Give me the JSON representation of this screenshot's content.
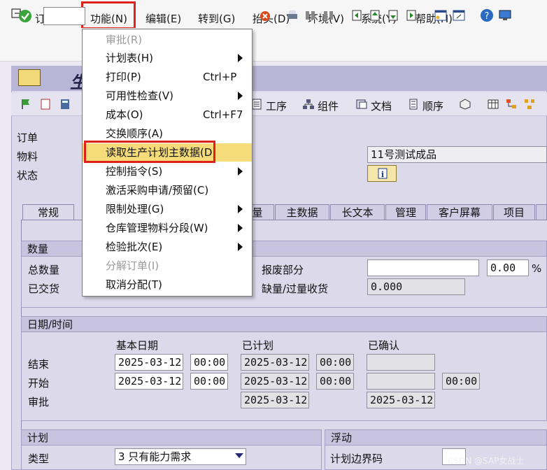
{
  "menubar": {
    "items": [
      "订单(O)",
      "功能(N)",
      "编辑(E)",
      "转到(G)",
      "抬头(D)",
      "环境(V)",
      "系统(Y)",
      "帮助(H)"
    ]
  },
  "screen": {
    "title": "生",
    "app_buttons": [
      "工序",
      "组件",
      "文档",
      "顺序"
    ]
  },
  "header": {
    "order_label": "订单",
    "material_label": "物料",
    "status_label": "状态",
    "material_desc": "11号测试成品",
    "info_symbol": "i"
  },
  "tabs": [
    "常规",
    "量",
    "主数据",
    "长文本",
    "管理",
    "客户屏幕",
    "项目"
  ],
  "quantities": {
    "header": "数量",
    "total_label": "总数量",
    "delivered_label": "已交货",
    "scrap_label": "报废部分",
    "scrap_pct": "0.00",
    "pct_sign": "%",
    "short_over_label": "缺量/过量收货",
    "short_over_value": "0.000"
  },
  "dates": {
    "header": "日期/时间",
    "col_basic": "基本日期",
    "col_planned": "已计划",
    "col_confirmed": "已确认",
    "end_label": "结束",
    "start_label": "开始",
    "release_label": "审批",
    "end_basic_date": "2025-03-12",
    "end_basic_time": "00:00",
    "end_planned_date": "2025-03-12",
    "end_planned_time": "00:00",
    "start_basic_date": "2025-03-12",
    "start_basic_time": "00:00",
    "start_planned_date": "2025-03-12",
    "start_planned_time": "00:00",
    "start_confirmed_time": "00:00",
    "release_planned_date": "2025-03-12",
    "release_confirmed_date": "2025-03-12"
  },
  "planning": {
    "header": "计划",
    "type_label": "类型",
    "type_value": "3 只有能力需求"
  },
  "float": {
    "header": "浮动",
    "sched_margin_label": "计划边界码"
  },
  "dropdown": {
    "items": [
      {
        "label": "审批(R)",
        "shortcut": "",
        "submenu": false,
        "disabled": true
      },
      {
        "label": "计划表(H)",
        "shortcut": "",
        "submenu": true,
        "disabled": false
      },
      {
        "label": "打印(P)",
        "shortcut": "Ctrl+P",
        "submenu": false,
        "disabled": false
      },
      {
        "label": "可用性检查(V)",
        "shortcut": "",
        "submenu": true,
        "disabled": false
      },
      {
        "label": "成本(O)",
        "shortcut": "Ctrl+F7",
        "submenu": false,
        "disabled": false
      },
      {
        "label": "交换顺序(A)",
        "shortcut": "",
        "submenu": false,
        "disabled": false
      },
      {
        "label": "读取生产计划主数据(D)",
        "shortcut": "",
        "submenu": false,
        "disabled": false
      },
      {
        "label": "控制指令(S)",
        "shortcut": "",
        "submenu": true,
        "disabled": false
      },
      {
        "label": "激活采购申请/预留(C)",
        "shortcut": "",
        "submenu": false,
        "disabled": false
      },
      {
        "label": "限制处理(G)",
        "shortcut": "",
        "submenu": true,
        "disabled": false
      },
      {
        "label": "仓库管理物料分段(W)",
        "shortcut": "",
        "submenu": true,
        "disabled": false
      },
      {
        "label": "检验批次(E)",
        "shortcut": "",
        "submenu": true,
        "disabled": false
      },
      {
        "label": "分解订单(I)",
        "shortcut": "",
        "submenu": false,
        "disabled": true
      },
      {
        "label": "取消分配(T)",
        "shortcut": "",
        "submenu": false,
        "disabled": false
      }
    ]
  },
  "watermark": "CSDN @SAP女战士",
  "colors": {
    "accent_red": "#e0201a",
    "highlight": "#f6db7a",
    "panel": "#dcd9ea"
  }
}
